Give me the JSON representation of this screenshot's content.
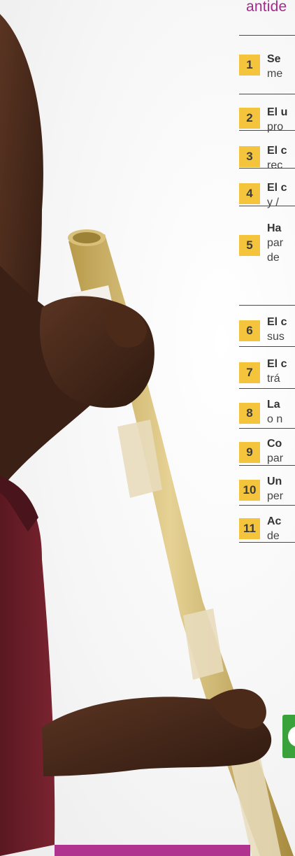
{
  "heading_fragment": "antide",
  "items": [
    {
      "num": "1",
      "bold": "Se",
      "line2": "me"
    },
    {
      "num": "2",
      "bold": "El u",
      "line2": "pro"
    },
    {
      "num": "3",
      "bold": "El c",
      "line2": "rec"
    },
    {
      "num": "4",
      "bold": "El c",
      "line2": "y /"
    },
    {
      "num": "5",
      "bold": "Ha",
      "line2": "par",
      "line3": "de"
    },
    {
      "num": "6",
      "bold": "El c",
      "line2": "sus"
    },
    {
      "num": "7",
      "bold": "El c",
      "line2": "trá"
    },
    {
      "num": "8",
      "bold": "La",
      "line2": "o n"
    },
    {
      "num": "9",
      "bold": "Co",
      "line2": "par"
    },
    {
      "num": "10",
      "bold": "Un",
      "line2": "per"
    },
    {
      "num": "11",
      "bold": "Ac",
      "line2": "de"
    }
  ],
  "colors": {
    "heading": "#a52a8f",
    "number_badge": "#f5c43d",
    "green_button": "#3aa23a",
    "bottom_bar": "#b0338f"
  }
}
